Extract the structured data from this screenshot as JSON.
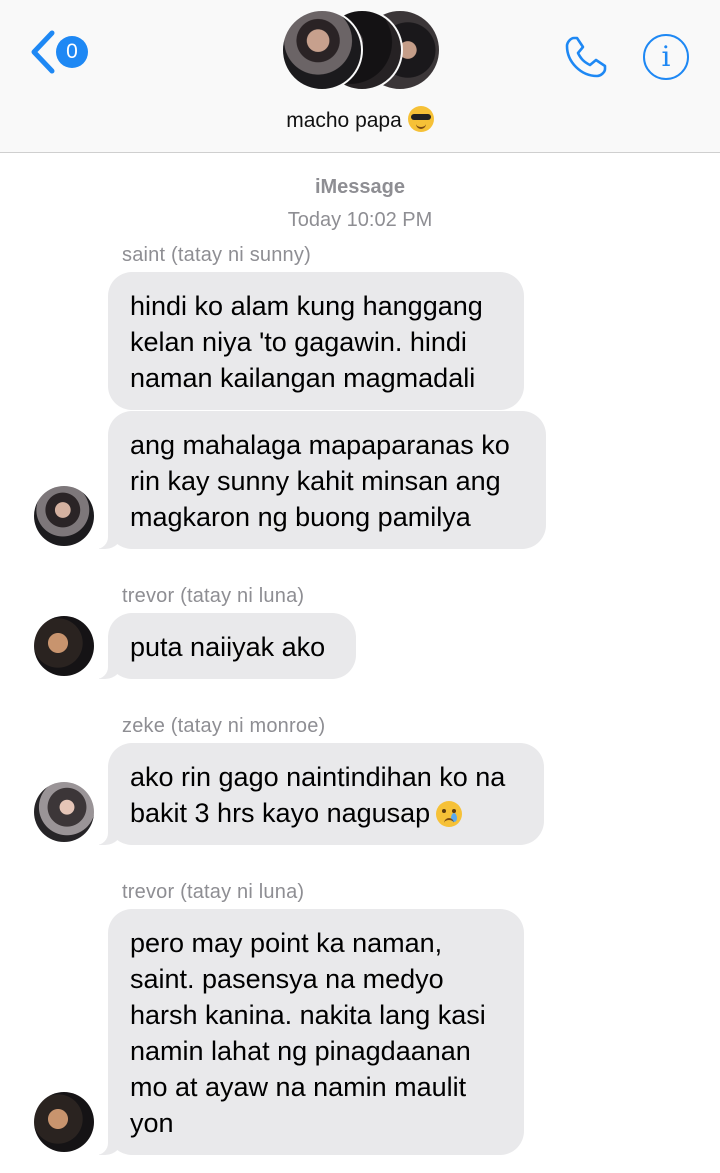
{
  "header": {
    "back_badge": "0",
    "group_name": "macho papa",
    "group_emoji": "smiling-face-with-sunglasses",
    "accent_color": "#1e88f4"
  },
  "thread": {
    "service": "iMessage",
    "timestamp": "Today 10:02 PM"
  },
  "messages": [
    {
      "sender": "saint (tatay ni sunny)",
      "text": "hindi ko alam kung hanggang kelan niya 'to gagawin. hindi naman kailangan magmadali"
    },
    {
      "text": "ang mahalaga mapaparanas ko rin kay sunny kahit minsan ang magkaron ng buong pamilya"
    },
    {
      "sender": "trevor (tatay ni luna)",
      "text": "puta naiiyak ako"
    },
    {
      "sender": "zeke (tatay ni monroe)",
      "text": "ako rin gago naintindihan ko na bakit 3 hrs kayo nagusap",
      "emoji": "crying-face"
    },
    {
      "sender": "trevor (tatay ni luna)",
      "text": "pero may point ka naman, saint. pasensya na medyo harsh kanina. nakita lang kasi namin lahat ng pinagdaanan mo at ayaw na namin maulit yon"
    }
  ]
}
